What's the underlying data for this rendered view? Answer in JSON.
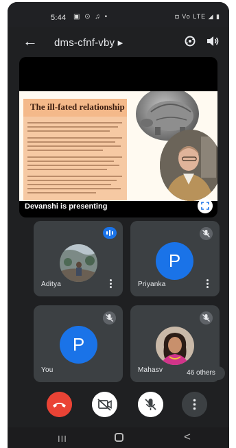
{
  "status_bar": {
    "time": "5:44",
    "left_icons": "▣ ⊙ ♫ •",
    "right_icons": "◘ Vo LTE ◢ ▮"
  },
  "top_bar": {
    "meeting_code": "dms-cfnf-vby ▸",
    "icons": [
      "back-arrow-icon",
      "switch-camera-icon",
      "speaker-icon"
    ]
  },
  "presentation": {
    "slide_title": "The ill-fated relationship",
    "presenter_label": "Devanshi is presenting"
  },
  "participants": [
    {
      "name": "Aditya",
      "avatar": "photo",
      "status": "speaking"
    },
    {
      "name": "Priyanka",
      "avatar_letter": "P",
      "status": "muted"
    },
    {
      "name": "You",
      "avatar_letter": "P",
      "status": "muted"
    },
    {
      "name": "Mahasv",
      "avatar": "photo",
      "status": "muted"
    }
  ],
  "others_count_label": "46 others",
  "controls": {
    "icons": [
      "end-call-icon",
      "camera-off-icon",
      "mic-off-icon",
      "more-options-icon"
    ]
  },
  "nav_bar": {
    "recents": "III",
    "back": "<"
  },
  "colors": {
    "accent": "#1a73e8",
    "end_call": "#ea4335",
    "background": "#202124",
    "tile": "#3c4043"
  }
}
